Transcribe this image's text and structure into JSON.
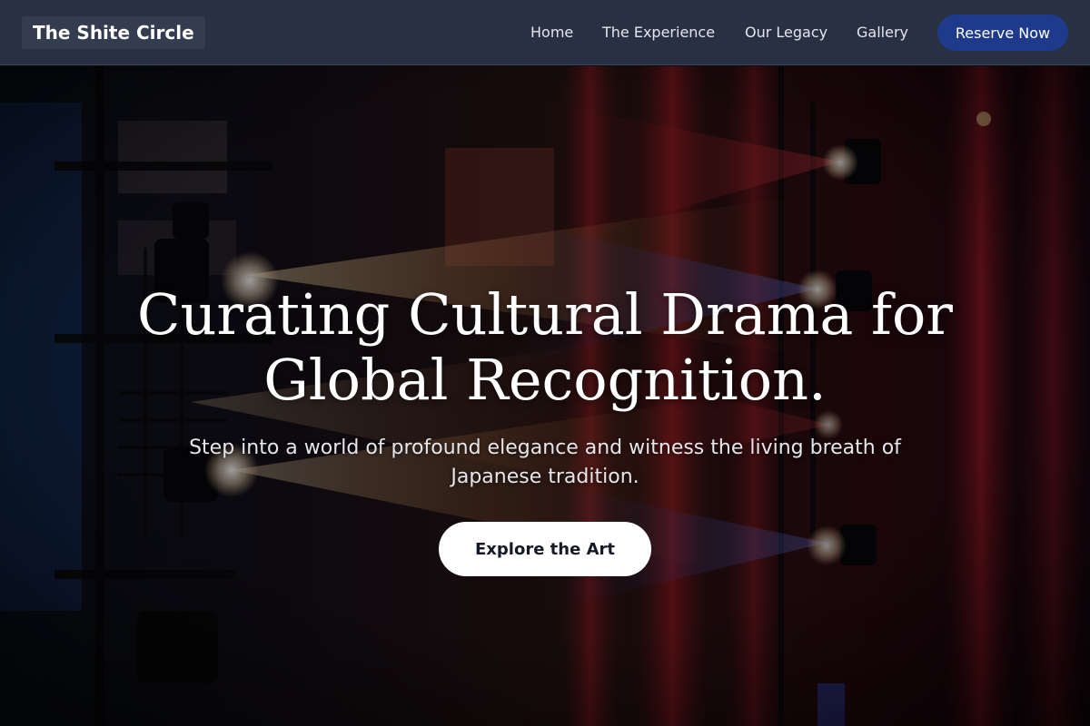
{
  "nav": {
    "brand": "The Shite Circle",
    "links": [
      "Home",
      "The Experience",
      "Our Legacy",
      "Gallery"
    ],
    "cta": "Reserve Now"
  },
  "hero": {
    "title_line1": "Curating Cultural Drama for",
    "title_line2": "Global Recognition.",
    "subtitle_line1": "Step into a world of profound elegance and witness the living breath of",
    "subtitle_line2": "Japanese tradition.",
    "button": "Explore the Art",
    "background_image": "theatre stage with spotlights and red curtains"
  },
  "colors": {
    "nav_bg": "#283042",
    "cta_bg": "#1e3a8a",
    "hero_button_bg": "#ffffff",
    "hero_button_text": "#151a26"
  }
}
